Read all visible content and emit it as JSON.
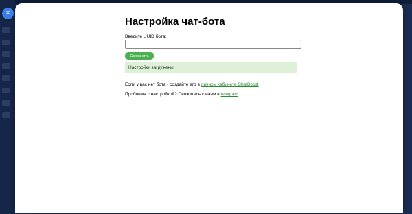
{
  "modal": {
    "title": "Настройка чат-бота",
    "close_icon": "×"
  },
  "form": {
    "uuid_label": "Введите UUID бота:",
    "uuid_value": "",
    "save_label": "Сохранить"
  },
  "status": {
    "message": "Настройки загружены",
    "color": "#dff0d8"
  },
  "info": {
    "no_bot_text": "Если у вас нет бота - создайте его в ",
    "no_bot_link": "личном кабинете ChatBoost",
    "problem_text": "Проблема с настройкой? Свяжитесь с нами в ",
    "problem_link": "telegram"
  },
  "colors": {
    "accent": "#4caf50",
    "close": "#3a7ee8",
    "link": "#2e8b36"
  }
}
